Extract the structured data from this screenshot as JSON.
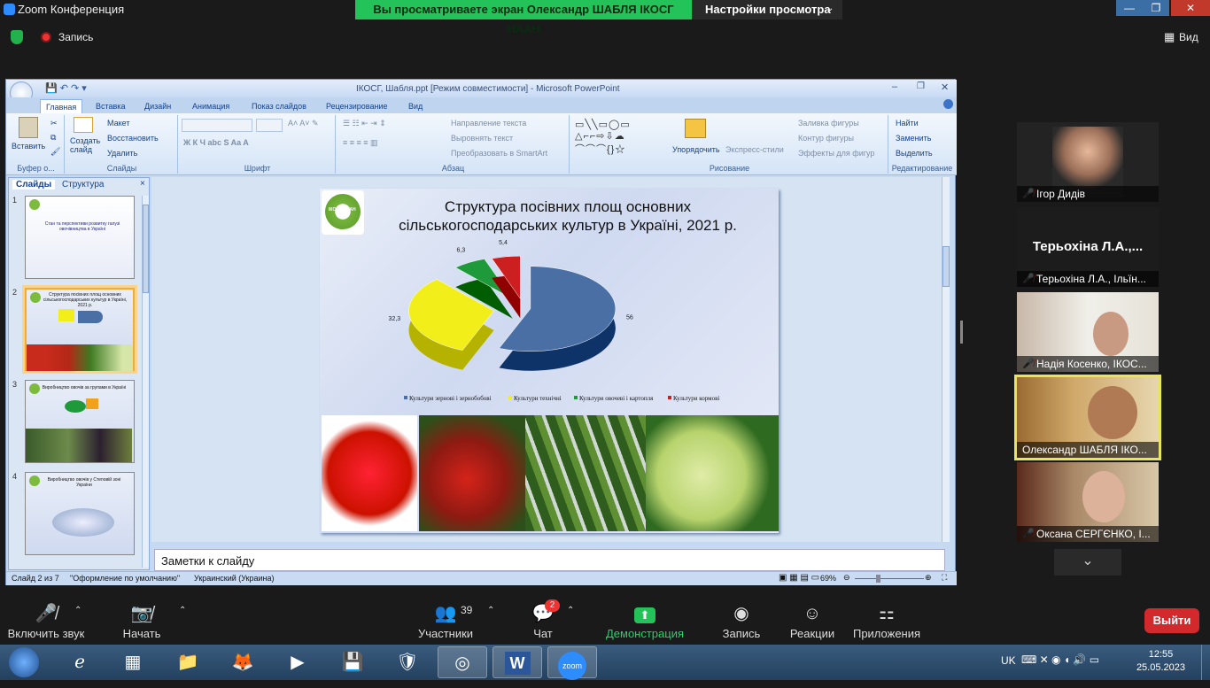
{
  "zoom": {
    "window_title": "Zoom Конференция",
    "share_banner": "Вы просматриваете экран Олександр ШАБЛЯ ІКОСГ НААН",
    "view_settings": "Настройки просмотра",
    "recording_label": "Запись",
    "view_label": "Вид",
    "participants": [
      {
        "name": "Ігор Дидів",
        "muted": true
      },
      {
        "name": "Терьохіна Л.А., Ільїн...",
        "big_name": "Терьохіна Л.А.,...",
        "muted": true
      },
      {
        "name": "Надія Косенко, ІКОС...",
        "muted": true
      },
      {
        "name": "Олександр ШАБЛЯ ІКО...",
        "muted": false,
        "active": true
      },
      {
        "name": "Оксана СЕРГЄНКО, І...",
        "muted": true
      }
    ],
    "toolbar": {
      "mic": "Включить звук",
      "video": "Начать видео",
      "participants": "Участники",
      "participants_count": "39",
      "chat": "Чат",
      "chat_badge": "2",
      "share": "Демонстрация экрана",
      "record": "Запись",
      "reactions": "Реакции",
      "apps": "Приложения",
      "leave": "Выйти"
    }
  },
  "ppt": {
    "title": "ІКОСГ, Шабля.ppt [Режим совместимости] - Microsoft PowerPoint",
    "tabs": [
      "Главная",
      "Вставка",
      "Дизайн",
      "Анимация",
      "Показ слайдов",
      "Рецензирование",
      "Вид"
    ],
    "groups": {
      "clipboard": {
        "label": "Буфер о...",
        "paste": "Вставить"
      },
      "slides": {
        "label": "Слайды",
        "new_slide": "Создать слайд",
        "layout": "Макет",
        "reset": "Восстановить",
        "delete": "Удалить"
      },
      "font": {
        "label": "Шрифт"
      },
      "paragraph": {
        "label": "Абзац",
        "text_direction": "Направление текста",
        "align_text": "Выровнять текст",
        "smartart": "Преобразовать в SmartArt"
      },
      "drawing": {
        "label": "Рисование",
        "arrange": "Упорядочить",
        "quick_styles": "Экспресс-стили",
        "fill": "Заливка фигуры",
        "outline": "Контур фигуры",
        "effects": "Эффекты для фигур"
      },
      "editing": {
        "label": "Редактирование",
        "find": "Найти",
        "replace": "Заменить",
        "select": "Выделить"
      }
    },
    "pane_tabs": [
      "Слайды",
      "Структура"
    ],
    "thumbnails": [
      {
        "num": "1",
        "caption": "Стан та перспективи розвитку галузі овочівництва в Україні"
      },
      {
        "num": "2",
        "caption": "Структура посівних площ основних сільськогосподарських культур в Україні, 2021 р."
      },
      {
        "num": "3",
        "caption": "Виробництво овочів за групами в Україні"
      },
      {
        "num": "4",
        "caption": "Виробництво овочів у Степовій зоні України"
      }
    ],
    "slide": {
      "logo_text": "ІКОСГ НААН",
      "title_line1": "Структура посівних площ основних",
      "title_line2": "сільськогосподарських культур в Україні, 2021 р."
    },
    "notes_placeholder": "Заметки к слайду",
    "status": {
      "slide_of": "Слайд 2 из 7",
      "theme": "\"Оформление по умолчанию\"",
      "language": "Украинский (Украина)",
      "zoom": "69%"
    }
  },
  "chart_data": {
    "type": "pie",
    "title": "Структура посівних площ основних сільськогосподарських культур в Україні, 2021 р.",
    "categories": [
      "Культури зернові і зернобобові",
      "Культури технічні",
      "Культури овочеві і картопля",
      "Культури кормові"
    ],
    "values": [
      56,
      32.3,
      6.3,
      5.4
    ],
    "value_labels": [
      "56",
      "32,3",
      "6,3",
      "5,4"
    ],
    "colors": [
      "#4a6fa5",
      "#f2ee1a",
      "#1f9a3a",
      "#cc1f1f"
    ],
    "legend": "bottom"
  },
  "taskbar": {
    "lang": "UK",
    "time": "12:55",
    "date": "25.05.2023"
  }
}
